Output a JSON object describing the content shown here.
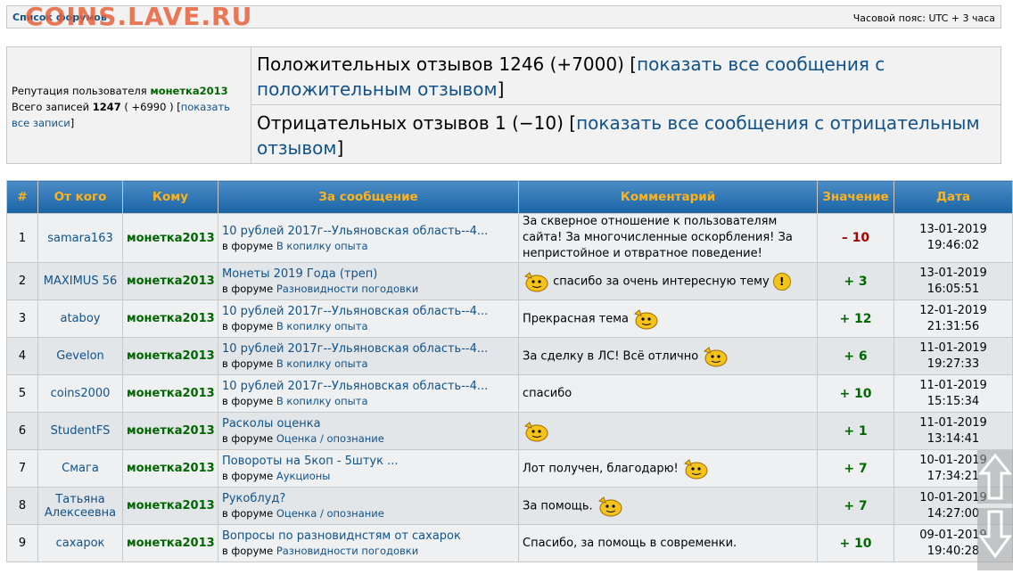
{
  "header": {
    "watermark": "COINS.LAVE.RU",
    "crumb": "Список форумов",
    "timezone": "Часовой пояс: UTC + 3 часа"
  },
  "summary": {
    "rep_label": "Репутация пользователя",
    "username": "монетка2013",
    "records_label": "Всего записей",
    "records_count": "1247",
    "records_delta": "( +6990 )",
    "show_all": "показать все записи",
    "positive_text": "Положительных отзывов 1246 (+7000)",
    "positive_link": "показать все сообщения с положительным отзывом",
    "negative_text": "Отрицательных отзывов 1 (−10)",
    "negative_link": "показать все сообщения с отрицательным отзывом"
  },
  "table": {
    "headers": [
      "#",
      "От кого",
      "Кому",
      "За сообщение",
      "Комментарий",
      "Значение",
      "Дата"
    ],
    "forum_prefix": "в форуме",
    "rows": [
      {
        "num": "1",
        "from": "samara163",
        "to": "монетка2013",
        "title": "10 рублей 2017г--Ульяновская область--4...",
        "forum": "В копилку опыта",
        "comment": "За скверное отношение к пользователям сайта! За многочисленные оскорбления! За непристойное и отвратное поведение!",
        "value": "– 10",
        "sign": "minus",
        "date": "13-01-2019",
        "time": "19:46:02"
      },
      {
        "num": "2",
        "from": "MAXIMUS 56",
        "to": "монетка2013",
        "title": "Монеты 2019 Года (треп)",
        "forum": "Разновидности погодовки",
        "comment": "спасибо за очень интересную тему",
        "value": "+ 3",
        "sign": "plus",
        "date": "13-01-2019",
        "time": "16:05:51"
      },
      {
        "num": "3",
        "from": "ataboy",
        "to": "монетка2013",
        "title": "10 рублей 2017г--Ульяновская область--4...",
        "forum": "В копилку опыта",
        "comment": "Прекрасная тема",
        "value": "+ 12",
        "sign": "plus",
        "date": "12-01-2019",
        "time": "21:31:56"
      },
      {
        "num": "4",
        "from": "Gevelon",
        "to": "монетка2013",
        "title": "10 рублей 2017г--Ульяновская область--4...",
        "forum": "В копилку опыта",
        "comment": "За сделку в ЛС! Всё отлично",
        "value": "+ 6",
        "sign": "plus",
        "date": "11-01-2019",
        "time": "19:27:33"
      },
      {
        "num": "5",
        "from": "coins2000",
        "to": "монетка2013",
        "title": "10 рублей 2017г--Ульяновская область--4...",
        "forum": "В копилку опыта",
        "comment": "спасибо",
        "value": "+ 10",
        "sign": "plus",
        "date": "11-01-2019",
        "time": "15:15:34"
      },
      {
        "num": "6",
        "from": "StudentFS",
        "to": "монетка2013",
        "title": "Расколы оценка",
        "forum": "Оценка / опознание",
        "comment": "",
        "value": "+ 1",
        "sign": "plus",
        "date": "11-01-2019",
        "time": "13:14:41"
      },
      {
        "num": "7",
        "from": "Смага",
        "to": "монетка2013",
        "title": "Повороты на 5коп - 5штук ...",
        "forum": "Аукционы",
        "comment": "Лот получен, благодарю!",
        "value": "+ 7",
        "sign": "plus",
        "date": "10-01-2019",
        "time": "17:34:21"
      },
      {
        "num": "8",
        "from": "Татьяна Алексеевна",
        "to": "монетка2013",
        "title": "Рукоблуд?",
        "forum": "Оценка / опознание",
        "comment": "За помощь.",
        "value": "+ 7",
        "sign": "plus",
        "date": "10-01-2019",
        "time": "14:27:00"
      },
      {
        "num": "9",
        "from": "сахарок",
        "to": "монетка2013",
        "title": "Вопросы по разновиднстям от сахарок",
        "forum": "Разновидности погодовки",
        "comment": "Спасибо, за помощь в современки.",
        "value": "+ 10",
        "sign": "plus",
        "date": "09-01-2019",
        "time": "19:40:28"
      }
    ]
  },
  "colors": {
    "header_gradient_top": "#4a8cc7",
    "header_text": "#ffb31a",
    "positive": "#006600",
    "negative": "#aa0000",
    "link": "#105289"
  }
}
